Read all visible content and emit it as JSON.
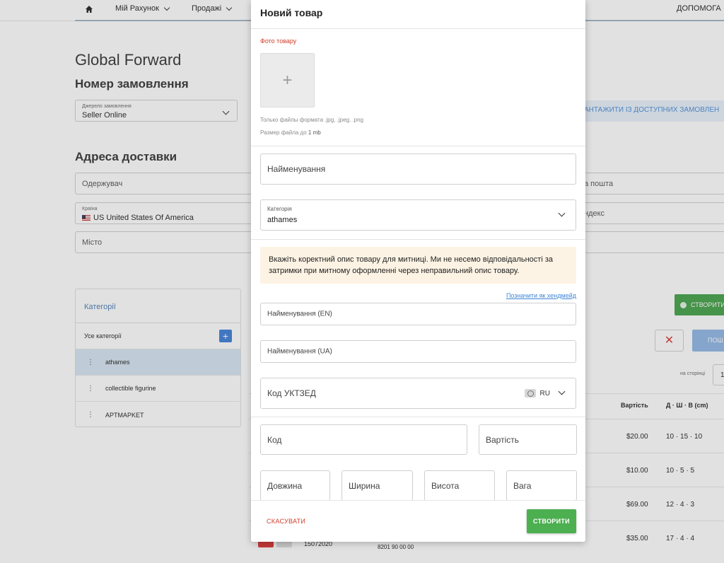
{
  "nav": {
    "account_label": "Мій Рахунок",
    "sales_label": "Продажі",
    "help_label": "ДОПОМОГА"
  },
  "background": {
    "company": "Global Forward",
    "order_heading": "Номер замовлення",
    "source": {
      "label": "Джерело замовлення",
      "value": "Seller Online"
    },
    "load_link": "АНТАЖИТИ ІЗ ДОСТУПНИХ ЗАМОВЛЕН",
    "address_heading": "Адреса доставки",
    "recipient_placeholder": "Одержувач",
    "country": {
      "label": "Країна",
      "code": "US",
      "value": "United States Of America"
    },
    "city_placeholder": "Місто",
    "email_placeholder": "а пошта",
    "zip_placeholder": "ндекс",
    "categories": {
      "title": "Категорії",
      "all_label": "Усе категорії",
      "items": [
        "athames",
        "collectible figurine",
        "APTMAPKET"
      ]
    },
    "create_label": "СТВОРИТИ",
    "search_label": "ПОШ",
    "per_page_label": "на сторінці",
    "per_page_value": "1",
    "table": {
      "col_cost": "Вартість",
      "col_dims": "Д · Ш · В (cm)",
      "rows": [
        {
          "cost": "$20.00",
          "dims": "10 · 15 · 10"
        },
        {
          "cost": "$10.00",
          "dims": "10 · 5 · 5"
        },
        {
          "cost": "$69.00",
          "dims": "12 · 4 · 3"
        },
        {
          "cost": "$35.00",
          "dims": "17 · 4 · 4"
        }
      ],
      "last_row_code": "15072020",
      "last_row_hs": "8201 90 00 00"
    }
  },
  "modal": {
    "title": "Новий товар",
    "photo_label": "Фото товару",
    "photo_add": "+",
    "hint_formats": "Только файлы формата .jpg, .jpeg, .png",
    "hint_size_prefix": "Размер файла до",
    "hint_size_value": "1 mb",
    "name_placeholder": "Найменування",
    "category": {
      "label": "Категорія",
      "value": "athames"
    },
    "notice": "Вкажіть коректний опис товару для митниці. Ми не несемо відповідальності за затримки при митному оформленні через неправильний опис товару.",
    "handmade_link": "Позначити як хендмейд",
    "name_en_placeholder": "Найменування (EN)",
    "name_ua_placeholder": "Найменування (UA)",
    "hs_code_placeholder": "Код УКТЗЕД",
    "hs_region": "RU",
    "code_placeholder": "Код",
    "cost_placeholder": "Вартість",
    "length_placeholder": "Довжина",
    "width_placeholder": "Ширина",
    "height_placeholder": "Висота",
    "weight_placeholder": "Вага",
    "cancel_label": "СКАСУВАТИ",
    "create_label": "СТВОРИТИ"
  },
  "colors": {
    "accent_green": "#4caf50",
    "accent_red": "#d03c2a",
    "link_blue": "#3f86d6",
    "notice_bg": "#fdf3e4"
  }
}
